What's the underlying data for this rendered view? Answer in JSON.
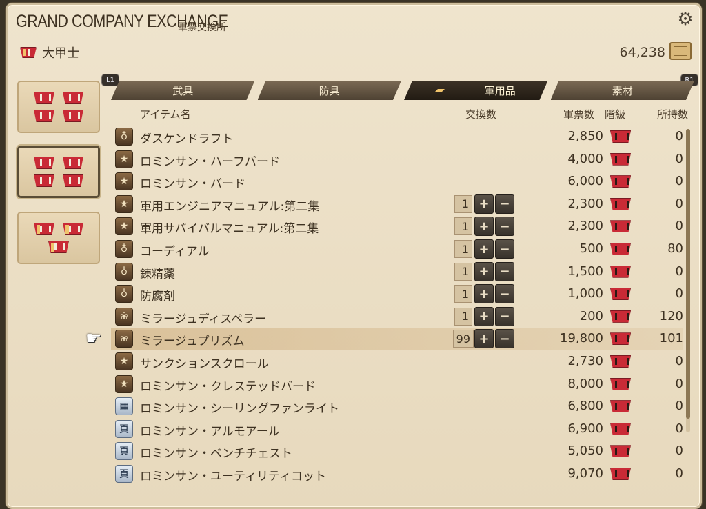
{
  "window": {
    "title": "GRAND COMPANY EXCHANGE",
    "subtitle": "軍票交換所",
    "rank": "大甲士",
    "seals": "64,238"
  },
  "tabs": [
    {
      "label": "武具"
    },
    {
      "label": "防具"
    },
    {
      "label": "軍用品"
    },
    {
      "label": "素材"
    }
  ],
  "tab_hints": {
    "left": "L1",
    "right": "R1"
  },
  "headers": {
    "item_name": "アイテム名",
    "quantity": "交換数",
    "cost": "軍票数",
    "rank": "階級",
    "owned": "所持数"
  },
  "items": [
    {
      "icon": "potion-icon",
      "name": "ダスケンドラフト",
      "qty": "",
      "cost": "2,850",
      "owned": "0"
    },
    {
      "icon": "star-icon",
      "name": "ロミンサン・ハーフバード",
      "qty": "",
      "cost": "4,000",
      "owned": "0"
    },
    {
      "icon": "star-icon",
      "name": "ロミンサン・バード",
      "qty": "",
      "cost": "6,000",
      "owned": "0"
    },
    {
      "icon": "star-icon",
      "name": "軍用エンジニアマニュアル:第二集",
      "qty": "1",
      "cost": "2,300",
      "owned": "0"
    },
    {
      "icon": "star-icon",
      "name": "軍用サバイバルマニュアル:第二集",
      "qty": "1",
      "cost": "2,300",
      "owned": "0"
    },
    {
      "icon": "potion-icon",
      "name": "コーディアル",
      "qty": "1",
      "cost": "500",
      "owned": "80"
    },
    {
      "icon": "potion-icon",
      "name": "錬精薬",
      "qty": "1",
      "cost": "1,500",
      "owned": "0"
    },
    {
      "icon": "potion-icon",
      "name": "防腐剤",
      "qty": "1",
      "cost": "1,000",
      "owned": "0"
    },
    {
      "icon": "crystal-icon",
      "name": "ミラージュディスペラー",
      "qty": "1",
      "cost": "200",
      "owned": "120"
    },
    {
      "icon": "crystal-icon",
      "name": "ミラージュプリズム",
      "qty": "99",
      "cost": "19,800",
      "owned": "101"
    },
    {
      "icon": "star-icon",
      "name": "サンクションスクロール",
      "qty": "",
      "cost": "2,730",
      "owned": "0"
    },
    {
      "icon": "star-icon",
      "name": "ロミンサン・クレステッドバード",
      "qty": "",
      "cost": "8,000",
      "owned": "0"
    },
    {
      "icon": "light-icon",
      "name": "ロミンサン・シーリングファンライト",
      "qty": "",
      "cost": "6,800",
      "owned": "0"
    },
    {
      "icon": "furniture-icon",
      "name": "ロミンサン・アルモアール",
      "qty": "",
      "cost": "6,900",
      "owned": "0"
    },
    {
      "icon": "furniture-icon",
      "name": "ロミンサン・ベンチチェスト",
      "qty": "",
      "cost": "5,050",
      "owned": "0"
    },
    {
      "icon": "furniture-icon",
      "name": "ロミンサン・ユーティリティコット",
      "qty": "",
      "cost": "9,070",
      "owned": "0"
    }
  ],
  "highlighted_index": 9,
  "colors": {
    "accent": "#c92a36",
    "panel": "#efe4cd",
    "tab_dark": "#2b2219"
  }
}
